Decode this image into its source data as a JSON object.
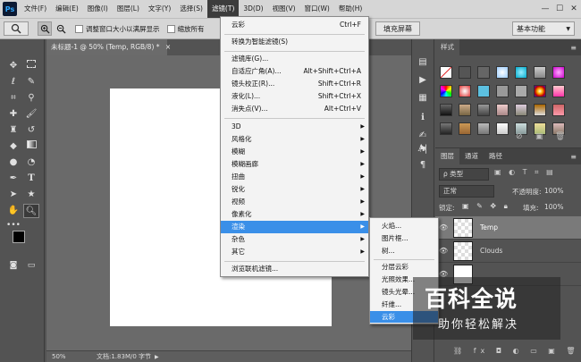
{
  "app": {
    "logo": "Ps"
  },
  "menubar": {
    "items": [
      "文件(F)",
      "编辑(E)",
      "图像(I)",
      "图层(L)",
      "文字(Y)",
      "选择(S)",
      "滤镜(T)",
      "3D(D)",
      "视图(V)",
      "窗口(W)",
      "帮助(H)"
    ],
    "active_index": 6,
    "window_buttons": [
      "—",
      "☐",
      "✕"
    ]
  },
  "options_bar": {
    "tool_icon": "zoom-icon",
    "resize_windows_label": "调整窗口大小以满屏显示",
    "zoom_all_label": "缩放所有",
    "fill_screen_label": "填充屏幕",
    "workspace_value": "基本功能"
  },
  "document": {
    "tab_title": "未标题-1 @ 50% (Temp, RGB/8) *",
    "tab_close": "×",
    "zoom": "50%",
    "doc_info": "文档:1.83M/0 字节"
  },
  "filter_menu": {
    "items": [
      {
        "label": "云彩",
        "shortcut": "Ctrl+F"
      },
      {
        "label": "转换为智能滤镜(S)",
        "shortcut": ""
      },
      {
        "label": "滤镜库(G)...",
        "shortcut": ""
      },
      {
        "label": "自适应广角(A)...",
        "shortcut": "Alt+Shift+Ctrl+A"
      },
      {
        "label": "镜头校正(R)...",
        "shortcut": "Shift+Ctrl+R"
      },
      {
        "label": "液化(L)...",
        "shortcut": "Shift+Ctrl+X"
      },
      {
        "label": "消失点(V)...",
        "shortcut": "Alt+Ctrl+V"
      },
      {
        "label": "3D",
        "shortcut": ""
      },
      {
        "label": "风格化",
        "shortcut": ""
      },
      {
        "label": "模糊",
        "shortcut": ""
      },
      {
        "label": "模糊画廊",
        "shortcut": ""
      },
      {
        "label": "扭曲",
        "shortcut": ""
      },
      {
        "label": "锐化",
        "shortcut": ""
      },
      {
        "label": "视频",
        "shortcut": ""
      },
      {
        "label": "像素化",
        "shortcut": ""
      },
      {
        "label": "渲染",
        "shortcut": ""
      },
      {
        "label": "杂色",
        "shortcut": ""
      },
      {
        "label": "其它",
        "shortcut": ""
      },
      {
        "label": "浏览联机滤镜...",
        "shortcut": ""
      }
    ],
    "highlighted": "渲染"
  },
  "render_submenu": {
    "items": [
      "火焰...",
      "图片框...",
      "树...",
      "分层云彩",
      "光照效果...",
      "镜头光晕...",
      "纤维...",
      "云彩"
    ],
    "highlighted": "云彩"
  },
  "styles_panel": {
    "tab": "样式"
  },
  "layers_panel": {
    "tabs": [
      "图层",
      "通道",
      "路径"
    ],
    "kind_filter": "ρ 类型",
    "blend_mode": "正常",
    "opacity_label": "不透明度:",
    "opacity_value": "100%",
    "lock_label": "锁定:",
    "fill_label": "填充:",
    "fill_value": "100%",
    "layers": [
      {
        "name": "Temp",
        "selected": true
      },
      {
        "name": "Clouds",
        "selected": false
      }
    ]
  },
  "watermark": {
    "title": "百科全说",
    "subtitle": "助你轻松解决"
  },
  "colors": {
    "menu_highlight": "#3a8fe8",
    "panel_bg": "#535353",
    "menubar_bg": "#d6d6d6"
  }
}
